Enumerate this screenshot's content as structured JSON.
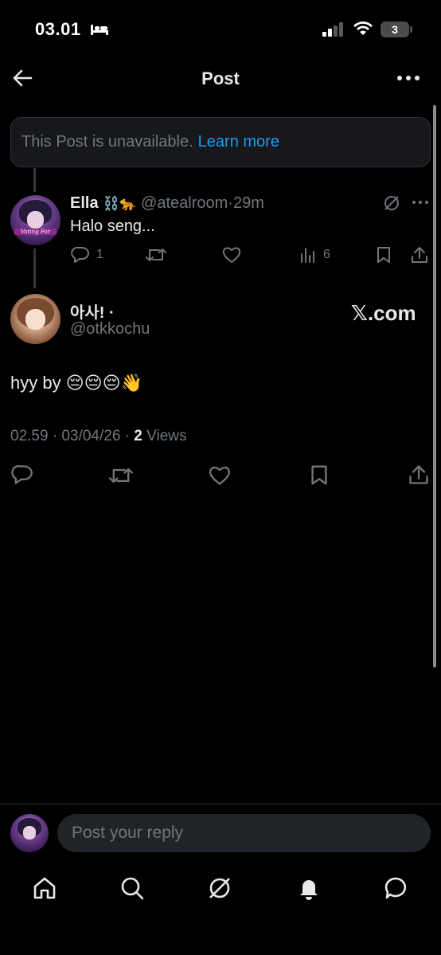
{
  "status_bar": {
    "time": "03.01",
    "battery": "3"
  },
  "header": {
    "title": "Post"
  },
  "notice": {
    "text": "This Post is unavailable.",
    "link": "Learn more"
  },
  "reply_post": {
    "author_name": "Ella",
    "author_emoji": "⛓️🐆",
    "handle": "@atealroom",
    "separator": "·",
    "time": "29m",
    "text": "Halo seng...",
    "replies": "1",
    "views": "6",
    "avatar_text": "Voting For"
  },
  "main_post": {
    "author_name": "아사! ·",
    "handle": "@otkkochu",
    "source": "𝕏.com",
    "text": "hyy by 😔😔😔👋",
    "timestamp": "02.59 · 03/04/26 · ",
    "views_count": "2",
    "views_label": " Views"
  },
  "reply_bar": {
    "placeholder": "Post your reply"
  },
  "icons": {
    "back": "arrow-left-icon",
    "more": "more-horizontal-icon",
    "grok": "grok-icon",
    "reply": "reply-icon",
    "retweet": "retweet-icon",
    "like": "heart-icon",
    "views": "views-icon",
    "bookmark": "bookmark-icon",
    "share": "share-icon",
    "home": "home-icon",
    "search": "search-icon",
    "notifications": "bell-icon",
    "messages": "messages-icon"
  },
  "colors": {
    "background": "#000000",
    "accent": "#1d9bf0",
    "muted": "#71767b",
    "text": "#e7e9ea"
  }
}
